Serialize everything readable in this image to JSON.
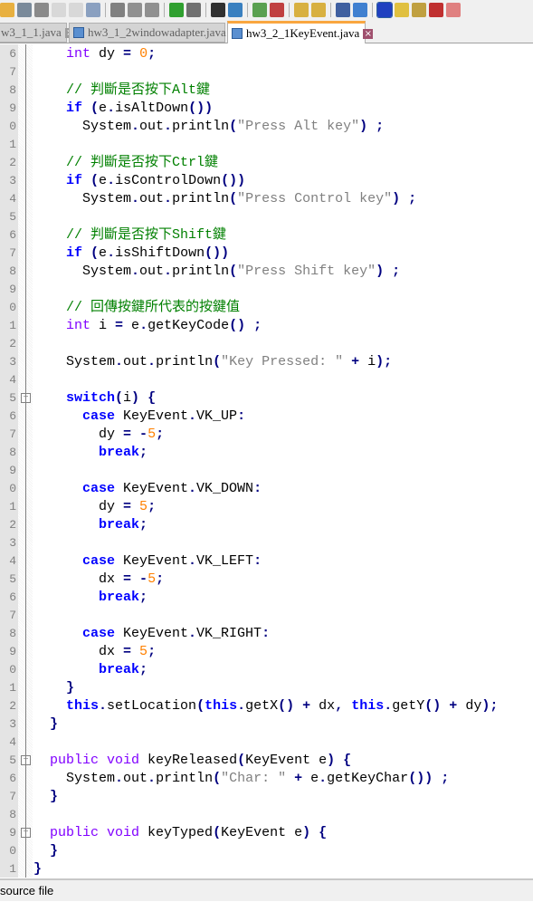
{
  "toolbar": {
    "icons": [
      "open-icon",
      "save-icon",
      "save-all-icon",
      "close-icon",
      "close-all-icon",
      "print-icon",
      "cut-icon",
      "copy-icon",
      "paste-icon",
      "undo-icon",
      "redo-icon",
      "find-icon",
      "replace-icon",
      "zoom-in-icon",
      "zoom-out-icon",
      "sync-vertical-icon",
      "sync-horizontal-icon",
      "word-wrap-icon",
      "show-all-chars-icon",
      "indent-guide-icon",
      "highlight-icon",
      "map-icon",
      "function-list-icon",
      "folder-icon"
    ]
  },
  "tabs": [
    {
      "label": "w3_1_1.java"
    },
    {
      "label": "hw3_1_2windowadapter.java"
    },
    {
      "label": "hw3_2_1KeyEvent.java",
      "active": true
    }
  ],
  "line_numbers": [
    "6",
    "7",
    "8",
    "9",
    "0",
    "1",
    "2",
    "3",
    "4",
    "5",
    "6",
    "7",
    "8",
    "9",
    "0",
    "1",
    "2",
    "3",
    "4",
    "5",
    "6",
    "7",
    "8",
    "9",
    "0",
    "1",
    "2",
    "3",
    "4",
    "5",
    "6",
    "7",
    "8",
    "9",
    "0",
    "1",
    "2",
    "3",
    "4",
    "5",
    "6",
    "7",
    "8",
    "9",
    "0",
    "1"
  ],
  "code": [
    {
      "i": 2,
      "t": [
        [
          "kw",
          "int"
        ],
        [
          "id",
          " dy "
        ],
        [
          "op",
          "="
        ],
        [
          "id",
          " "
        ],
        [
          "num",
          "0"
        ],
        [
          "op",
          ";"
        ]
      ]
    },
    {
      "i": 0,
      "t": []
    },
    {
      "i": 2,
      "t": [
        [
          "cm",
          "// 判斷是否按下Alt鍵"
        ]
      ]
    },
    {
      "i": 2,
      "t": [
        [
          "kb",
          "if"
        ],
        [
          "id",
          " "
        ],
        [
          "op",
          "("
        ],
        [
          "id",
          "e"
        ],
        [
          "op",
          "."
        ],
        [
          "id",
          "isAltDown"
        ],
        [
          "op",
          "())"
        ]
      ]
    },
    {
      "i": 3,
      "t": [
        [
          "id",
          "System"
        ],
        [
          "op",
          "."
        ],
        [
          "id",
          "out"
        ],
        [
          "op",
          "."
        ],
        [
          "id",
          "println"
        ],
        [
          "op",
          "("
        ],
        [
          "str",
          "\"Press Alt key\""
        ],
        [
          "op",
          ")"
        ],
        [
          "id",
          " "
        ],
        [
          "op",
          ";"
        ]
      ]
    },
    {
      "i": 0,
      "t": []
    },
    {
      "i": 2,
      "t": [
        [
          "cm",
          "// 判斷是否按下Ctrl鍵"
        ]
      ]
    },
    {
      "i": 2,
      "t": [
        [
          "kb",
          "if"
        ],
        [
          "id",
          " "
        ],
        [
          "op",
          "("
        ],
        [
          "id",
          "e"
        ],
        [
          "op",
          "."
        ],
        [
          "id",
          "isControlDown"
        ],
        [
          "op",
          "())"
        ]
      ]
    },
    {
      "i": 3,
      "t": [
        [
          "id",
          "System"
        ],
        [
          "op",
          "."
        ],
        [
          "id",
          "out"
        ],
        [
          "op",
          "."
        ],
        [
          "id",
          "println"
        ],
        [
          "op",
          "("
        ],
        [
          "str",
          "\"Press Control key\""
        ],
        [
          "op",
          ")"
        ],
        [
          "id",
          " "
        ],
        [
          "op",
          ";"
        ]
      ]
    },
    {
      "i": 0,
      "t": []
    },
    {
      "i": 2,
      "t": [
        [
          "cm",
          "// 判斷是否按下Shift鍵"
        ]
      ]
    },
    {
      "i": 2,
      "t": [
        [
          "kb",
          "if"
        ],
        [
          "id",
          " "
        ],
        [
          "op",
          "("
        ],
        [
          "id",
          "e"
        ],
        [
          "op",
          "."
        ],
        [
          "id",
          "isShiftDown"
        ],
        [
          "op",
          "())"
        ]
      ]
    },
    {
      "i": 3,
      "t": [
        [
          "id",
          "System"
        ],
        [
          "op",
          "."
        ],
        [
          "id",
          "out"
        ],
        [
          "op",
          "."
        ],
        [
          "id",
          "println"
        ],
        [
          "op",
          "("
        ],
        [
          "str",
          "\"Press Shift key\""
        ],
        [
          "op",
          ")"
        ],
        [
          "id",
          " "
        ],
        [
          "op",
          ";"
        ]
      ]
    },
    {
      "i": 0,
      "t": []
    },
    {
      "i": 2,
      "t": [
        [
          "cm",
          "// 回傳按鍵所代表的按鍵值"
        ]
      ]
    },
    {
      "i": 2,
      "t": [
        [
          "kw",
          "int"
        ],
        [
          "id",
          " i "
        ],
        [
          "op",
          "="
        ],
        [
          "id",
          " e"
        ],
        [
          "op",
          "."
        ],
        [
          "id",
          "getKeyCode"
        ],
        [
          "op",
          "()"
        ],
        [
          "id",
          " "
        ],
        [
          "op",
          ";"
        ]
      ]
    },
    {
      "i": 0,
      "t": []
    },
    {
      "i": 2,
      "t": [
        [
          "id",
          "System"
        ],
        [
          "op",
          "."
        ],
        [
          "id",
          "out"
        ],
        [
          "op",
          "."
        ],
        [
          "id",
          "println"
        ],
        [
          "op",
          "("
        ],
        [
          "str",
          "\"Key Pressed: \""
        ],
        [
          "id",
          " "
        ],
        [
          "op",
          "+"
        ],
        [
          "id",
          " i"
        ],
        [
          "op",
          ");"
        ]
      ]
    },
    {
      "i": 0,
      "t": []
    },
    {
      "i": 2,
      "t": [
        [
          "kb",
          "switch"
        ],
        [
          "op",
          "("
        ],
        [
          "id",
          "i"
        ],
        [
          "op",
          ")"
        ],
        [
          "id",
          " "
        ],
        [
          "op",
          "{"
        ]
      ],
      "fold": "box"
    },
    {
      "i": 3,
      "t": [
        [
          "kb",
          "case"
        ],
        [
          "id",
          " KeyEvent"
        ],
        [
          "op",
          "."
        ],
        [
          "id",
          "VK_UP"
        ],
        [
          "op",
          ":"
        ]
      ]
    },
    {
      "i": 4,
      "t": [
        [
          "id",
          "dy "
        ],
        [
          "op",
          "="
        ],
        [
          "id",
          " "
        ],
        [
          "op",
          "-"
        ],
        [
          "num",
          "5"
        ],
        [
          "op",
          ";"
        ]
      ]
    },
    {
      "i": 4,
      "t": [
        [
          "kb",
          "break"
        ],
        [
          "op",
          ";"
        ]
      ]
    },
    {
      "i": 0,
      "t": []
    },
    {
      "i": 3,
      "t": [
        [
          "kb",
          "case"
        ],
        [
          "id",
          " KeyEvent"
        ],
        [
          "op",
          "."
        ],
        [
          "id",
          "VK_DOWN"
        ],
        [
          "op",
          ":"
        ]
      ]
    },
    {
      "i": 4,
      "t": [
        [
          "id",
          "dy "
        ],
        [
          "op",
          "="
        ],
        [
          "id",
          " "
        ],
        [
          "num",
          "5"
        ],
        [
          "op",
          ";"
        ]
      ]
    },
    {
      "i": 4,
      "t": [
        [
          "kb",
          "break"
        ],
        [
          "op",
          ";"
        ]
      ]
    },
    {
      "i": 0,
      "t": []
    },
    {
      "i": 3,
      "t": [
        [
          "kb",
          "case"
        ],
        [
          "id",
          " KeyEvent"
        ],
        [
          "op",
          "."
        ],
        [
          "id",
          "VK_LEFT"
        ],
        [
          "op",
          ":"
        ]
      ]
    },
    {
      "i": 4,
      "t": [
        [
          "id",
          "dx "
        ],
        [
          "op",
          "="
        ],
        [
          "id",
          " "
        ],
        [
          "op",
          "-"
        ],
        [
          "num",
          "5"
        ],
        [
          "op",
          ";"
        ]
      ]
    },
    {
      "i": 4,
      "t": [
        [
          "kb",
          "break"
        ],
        [
          "op",
          ";"
        ]
      ]
    },
    {
      "i": 0,
      "t": []
    },
    {
      "i": 3,
      "t": [
        [
          "kb",
          "case"
        ],
        [
          "id",
          " KeyEvent"
        ],
        [
          "op",
          "."
        ],
        [
          "id",
          "VK_RIGHT"
        ],
        [
          "op",
          ":"
        ]
      ]
    },
    {
      "i": 4,
      "t": [
        [
          "id",
          "dx "
        ],
        [
          "op",
          "="
        ],
        [
          "id",
          " "
        ],
        [
          "num",
          "5"
        ],
        [
          "op",
          ";"
        ]
      ]
    },
    {
      "i": 4,
      "t": [
        [
          "kb",
          "break"
        ],
        [
          "op",
          ";"
        ]
      ]
    },
    {
      "i": 2,
      "t": [
        [
          "op",
          "}"
        ]
      ]
    },
    {
      "i": 2,
      "t": [
        [
          "kb",
          "this"
        ],
        [
          "op",
          "."
        ],
        [
          "id",
          "setLocation"
        ],
        [
          "op",
          "("
        ],
        [
          "kb",
          "this"
        ],
        [
          "op",
          "."
        ],
        [
          "id",
          "getX"
        ],
        [
          "op",
          "()"
        ],
        [
          "id",
          " "
        ],
        [
          "op",
          "+"
        ],
        [
          "id",
          " dx"
        ],
        [
          "op",
          ","
        ],
        [
          "id",
          " "
        ],
        [
          "kb",
          "this"
        ],
        [
          "op",
          "."
        ],
        [
          "id",
          "getY"
        ],
        [
          "op",
          "()"
        ],
        [
          "id",
          " "
        ],
        [
          "op",
          "+"
        ],
        [
          "id",
          " dy"
        ],
        [
          "op",
          ");"
        ]
      ]
    },
    {
      "i": 1,
      "t": [
        [
          "op",
          "}"
        ]
      ]
    },
    {
      "i": 0,
      "t": []
    },
    {
      "i": 1,
      "t": [
        [
          "kw",
          "public"
        ],
        [
          "id",
          " "
        ],
        [
          "kw",
          "void"
        ],
        [
          "id",
          " keyReleased"
        ],
        [
          "op",
          "("
        ],
        [
          "id",
          "KeyEvent e"
        ],
        [
          "op",
          ")"
        ],
        [
          "id",
          " "
        ],
        [
          "op",
          "{"
        ]
      ],
      "fold": "box"
    },
    {
      "i": 2,
      "t": [
        [
          "id",
          "System"
        ],
        [
          "op",
          "."
        ],
        [
          "id",
          "out"
        ],
        [
          "op",
          "."
        ],
        [
          "id",
          "println"
        ],
        [
          "op",
          "("
        ],
        [
          "str",
          "\"Char: \""
        ],
        [
          "id",
          " "
        ],
        [
          "op",
          "+"
        ],
        [
          "id",
          " e"
        ],
        [
          "op",
          "."
        ],
        [
          "id",
          "getKeyChar"
        ],
        [
          "op",
          "())"
        ],
        [
          "id",
          " "
        ],
        [
          "op",
          ";"
        ]
      ]
    },
    {
      "i": 1,
      "t": [
        [
          "op",
          "}"
        ]
      ]
    },
    {
      "i": 0,
      "t": []
    },
    {
      "i": 1,
      "t": [
        [
          "kw",
          "public"
        ],
        [
          "id",
          " "
        ],
        [
          "kw",
          "void"
        ],
        [
          "id",
          " keyTyped"
        ],
        [
          "op",
          "("
        ],
        [
          "id",
          "KeyEvent e"
        ],
        [
          "op",
          ")"
        ],
        [
          "id",
          " "
        ],
        [
          "op",
          "{"
        ]
      ],
      "fold": "box"
    },
    {
      "i": 1,
      "t": [
        [
          "op",
          "}"
        ]
      ]
    },
    {
      "i": 0,
      "t": [
        [
          "op",
          "}"
        ]
      ]
    }
  ],
  "status": {
    "text": "source file"
  }
}
